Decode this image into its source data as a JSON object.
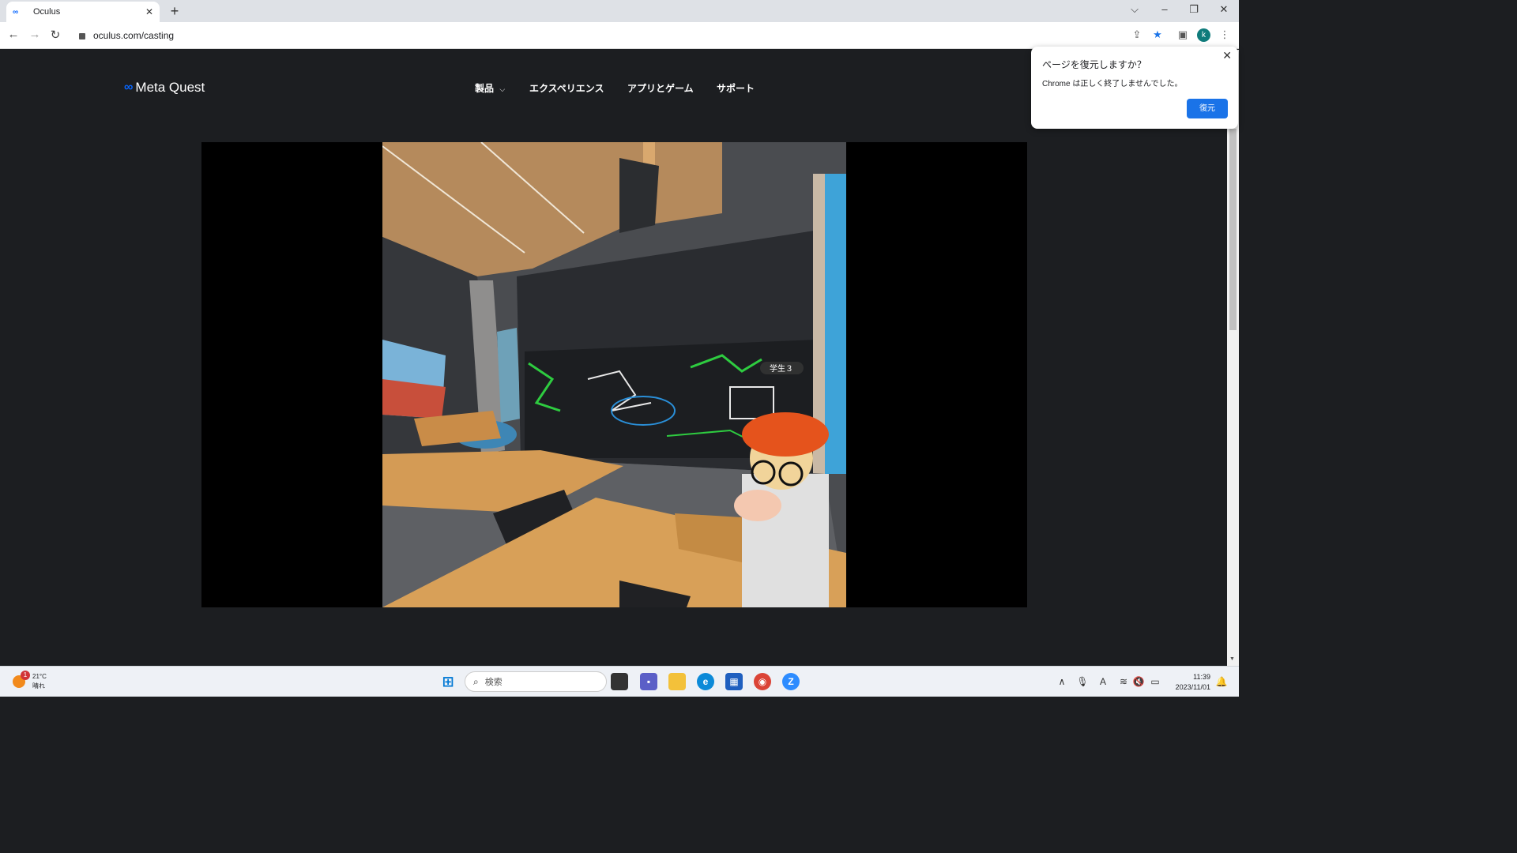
{
  "browser": {
    "tab_title": "Oculus",
    "tab_favicon": "∞",
    "url": "oculus.com/casting",
    "profile_initial": "k"
  },
  "site": {
    "logo_text": "Meta Quest",
    "logo_symbol": "∞",
    "nav": [
      "製品",
      "エクスペリエンス",
      "アプリとゲーム",
      "サポート"
    ],
    "nav_dropdown_glyph": "⌵"
  },
  "video": {
    "scene_label": "学生３"
  },
  "restore_dialog": {
    "title": "ページを復元しますか？",
    "message": "Chrome は正しく終了しませんでした。",
    "button": "復元"
  },
  "taskbar": {
    "weather_temp": "21°C",
    "weather_desc": "晴れ",
    "weather_badge": "1",
    "search_placeholder": "検索",
    "time": "11:39",
    "date": "2023/11/01"
  },
  "colors": {
    "meta_blue": "#0866ff",
    "chrome_blue": "#1a73e8",
    "page_bg": "#1c1e21"
  }
}
